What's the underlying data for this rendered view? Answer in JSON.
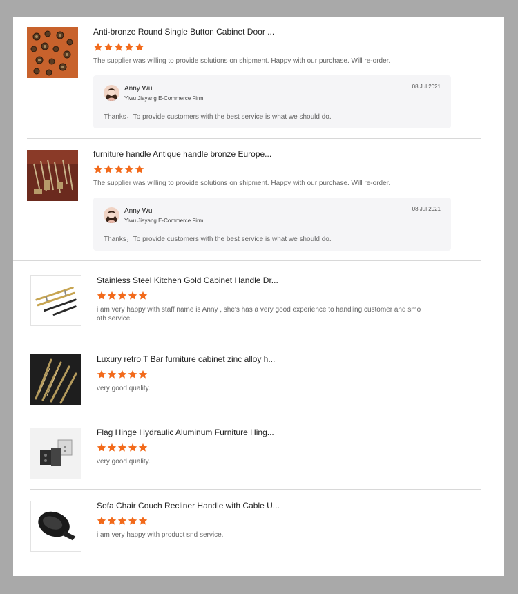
{
  "colors": {
    "star": "#f26a1b",
    "accent": "#f26a1b"
  },
  "reviews": [
    {
      "title": "Anti-bronze Round Single Button Cabinet Door ...",
      "rating": 5,
      "text": "The supplier was willing to provide solutions on shipment. Happy with our purchase. Will re-order.",
      "image": "bronze-knobs-image",
      "reply": {
        "name": "Anny Wu",
        "company": "Yiwu Jiayang E-Commerce Firm",
        "date": "08 Jul 2021",
        "text": "Thanks，To provide customers with the best service is what we should do."
      }
    },
    {
      "title": "furniture handle Antique handle bronze Europe...",
      "rating": 5,
      "text": "The supplier was willing to provide solutions on shipment. Happy with our purchase. Will re-order.",
      "image": "antique-handles-image",
      "reply": {
        "name": "Anny Wu",
        "company": "Yiwu Jiayang E-Commerce Firm",
        "date": "08 Jul 2021",
        "text": "Thanks，To provide customers with the best service is what we should do."
      }
    },
    {
      "title": "Stainless Steel Kitchen Gold Cabinet Handle Dr...",
      "rating": 5,
      "text_line1": "i am very happy with staff name is  Anny , she's has a  very good experience to handling customer and smo",
      "text_line2": "oth service.",
      "image": "gold-bar-handles-image"
    },
    {
      "title": "Luxury retro T Bar furniture cabinet zinc alloy h...",
      "rating": 5,
      "text": "very good quality.",
      "image": "t-bar-handles-image"
    },
    {
      "title": "Flag Hinge Hydraulic Aluminum Furniture Hing...",
      "rating": 5,
      "text": "very good quality.",
      "image": "flag-hinge-image"
    },
    {
      "title": "Sofa Chair Couch Recliner Handle with Cable U...",
      "rating": 5,
      "text": "i am very happy with product snd service.",
      "image": "recliner-handle-image"
    }
  ]
}
